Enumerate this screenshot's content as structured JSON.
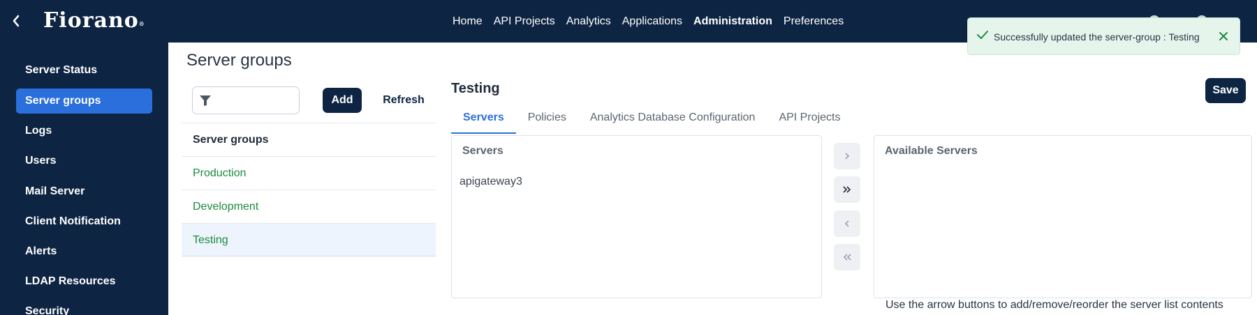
{
  "header": {
    "back_icon": "chevron-left-icon",
    "logo_text": "Fiorano",
    "logo_mark": "®",
    "nav": [
      {
        "label": "Home",
        "active": false
      },
      {
        "label": "API Projects",
        "active": false
      },
      {
        "label": "Analytics",
        "active": false
      },
      {
        "label": "Applications",
        "active": false
      },
      {
        "label": "Administration",
        "active": true
      },
      {
        "label": "Preferences",
        "active": false
      }
    ]
  },
  "sidebar": {
    "items": [
      {
        "label": "Server Status",
        "active": false
      },
      {
        "label": "Server groups",
        "active": true
      },
      {
        "label": "Logs",
        "active": false
      },
      {
        "label": "Users",
        "active": false
      },
      {
        "label": "Mail Server",
        "active": false
      },
      {
        "label": "Client Notification",
        "active": false
      },
      {
        "label": "Alerts",
        "active": false
      },
      {
        "label": "LDAP Resources",
        "active": false
      },
      {
        "label": "Security",
        "active": false
      }
    ]
  },
  "main": {
    "title": "Server groups",
    "filter": {
      "icon": "filter-icon",
      "value": "",
      "placeholder": ""
    },
    "add_label": "Add",
    "refresh_label": "Refresh",
    "list": {
      "header": "Server groups",
      "items": [
        "Production",
        "Development",
        "Testing"
      ],
      "selected": "Testing"
    }
  },
  "detail": {
    "title": "Testing",
    "save_label": "Save",
    "tabs": [
      {
        "label": "Servers",
        "active": true
      },
      {
        "label": "Policies",
        "active": false
      },
      {
        "label": "Analytics Database Configuration",
        "active": false
      },
      {
        "label": "API Projects",
        "active": false
      }
    ],
    "servers_panel": {
      "title": "Servers",
      "items": [
        "apigateway3"
      ]
    },
    "available_panel": {
      "title": "Available Servers",
      "items": []
    },
    "arrows": [
      {
        "symbol": "›",
        "icon": "chevron-right-icon"
      },
      {
        "symbol": "»",
        "icon": "double-chevron-right-icon"
      },
      {
        "symbol": "‹",
        "icon": "chevron-left-icon"
      },
      {
        "symbol": "«",
        "icon": "double-chevron-left-icon"
      }
    ],
    "hint": "Use the arrow buttons to add/remove/reorder the server list contents"
  },
  "toast": {
    "message": "Successfully updated the server-group : Testing",
    "icon": "check-icon",
    "close_icon": "close-icon"
  },
  "colors": {
    "navy": "#0d2443",
    "accent_blue": "#2a6fdb",
    "success_green": "#1c8a3c",
    "toast_bg": "#e6f5ec"
  }
}
